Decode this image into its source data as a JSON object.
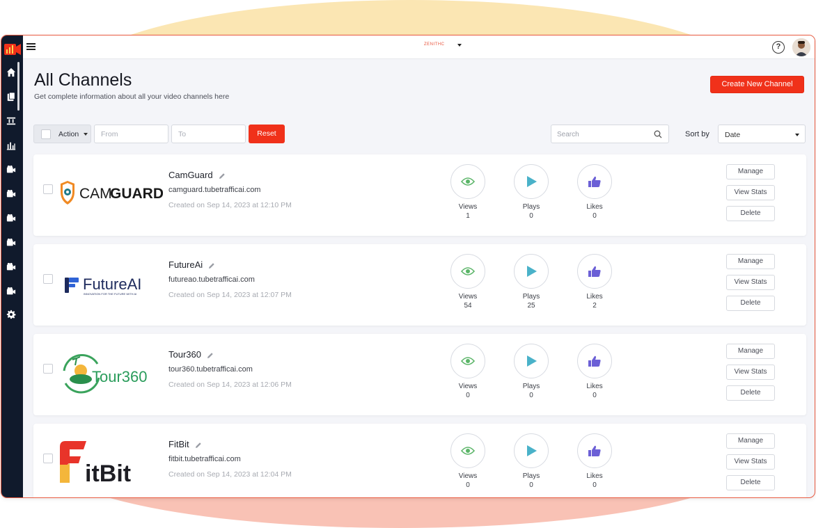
{
  "app": {
    "brand": "ZENITHC",
    "avatar_initials": ""
  },
  "header": {
    "title": "All Channels",
    "subtitle": "Get complete information about all your video channels here",
    "create_button": "Create New Channel"
  },
  "filters": {
    "action_label": "Action",
    "from_placeholder": "From",
    "to_placeholder": "To",
    "reset_label": "Reset",
    "search_placeholder": "Search",
    "sort_label": "Sort by",
    "sort_value": "Date"
  },
  "stat_labels": {
    "views": "Views",
    "plays": "Plays",
    "likes": "Likes"
  },
  "row_buttons": {
    "manage": "Manage",
    "view_stats": "View Stats",
    "delete": "Delete"
  },
  "channels": [
    {
      "name": "CamGuard",
      "url": "camguard.tubetrafficai.com",
      "created": "Created on Sep 14, 2023 at 12:10 PM",
      "views": "1",
      "plays": "0",
      "likes": "0",
      "logo_text_a": "CAM",
      "logo_text_b": "GUARD"
    },
    {
      "name": "FutureAi",
      "url": "futureao.tubetrafficai.com",
      "created": "Created on Sep 14, 2023 at 12:07 PM",
      "views": "54",
      "plays": "25",
      "likes": "2",
      "logo_text_a": "FutureAI",
      "logo_tagline": "INNOVATION FOR THE FUTURE WITH AI"
    },
    {
      "name": "Tour360",
      "url": "tour360.tubetrafficai.com",
      "created": "Created on Sep 14, 2023 at 12:06 PM",
      "views": "0",
      "plays": "0",
      "likes": "0",
      "logo_text_a": "Tour360"
    },
    {
      "name": "FitBit",
      "url": "fitbit.tubetrafficai.com",
      "created": "Created on Sep 14, 2023 at 12:04 PM",
      "views": "0",
      "plays": "0",
      "likes": "0",
      "logo_text_a": "itBit"
    }
  ],
  "colors": {
    "accent": "#f0311a",
    "sidebar": "#101a2c",
    "eye": "#5bb568",
    "play": "#4ab2c9",
    "like": "#6b5fd6"
  },
  "sidebar_icons": [
    "home-icon",
    "pages-icon",
    "layout-icon",
    "chart-icon",
    "video-icon",
    "video-icon",
    "video-icon",
    "video-icon",
    "video-icon",
    "video-icon",
    "settings-icon"
  ]
}
